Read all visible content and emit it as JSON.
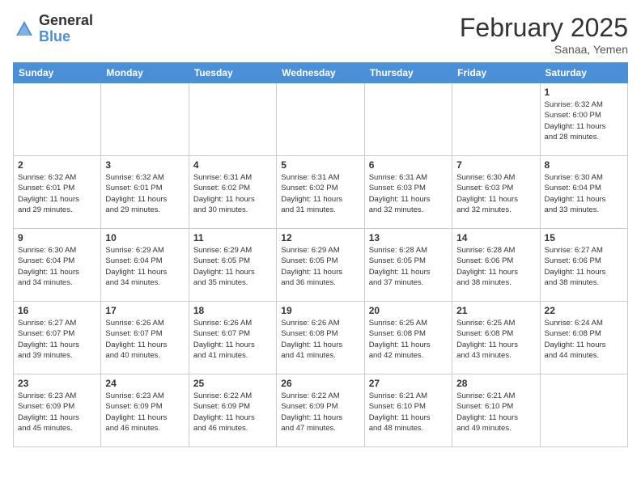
{
  "logo": {
    "general": "General",
    "blue": "Blue"
  },
  "title": "February 2025",
  "location": "Sanaa, Yemen",
  "days_of_week": [
    "Sunday",
    "Monday",
    "Tuesday",
    "Wednesday",
    "Thursday",
    "Friday",
    "Saturday"
  ],
  "weeks": [
    [
      {
        "day": "",
        "info": ""
      },
      {
        "day": "",
        "info": ""
      },
      {
        "day": "",
        "info": ""
      },
      {
        "day": "",
        "info": ""
      },
      {
        "day": "",
        "info": ""
      },
      {
        "day": "",
        "info": ""
      },
      {
        "day": "1",
        "info": "Sunrise: 6:32 AM\nSunset: 6:00 PM\nDaylight: 11 hours\nand 28 minutes."
      }
    ],
    [
      {
        "day": "2",
        "info": "Sunrise: 6:32 AM\nSunset: 6:01 PM\nDaylight: 11 hours\nand 29 minutes."
      },
      {
        "day": "3",
        "info": "Sunrise: 6:32 AM\nSunset: 6:01 PM\nDaylight: 11 hours\nand 29 minutes."
      },
      {
        "day": "4",
        "info": "Sunrise: 6:31 AM\nSunset: 6:02 PM\nDaylight: 11 hours\nand 30 minutes."
      },
      {
        "day": "5",
        "info": "Sunrise: 6:31 AM\nSunset: 6:02 PM\nDaylight: 11 hours\nand 31 minutes."
      },
      {
        "day": "6",
        "info": "Sunrise: 6:31 AM\nSunset: 6:03 PM\nDaylight: 11 hours\nand 32 minutes."
      },
      {
        "day": "7",
        "info": "Sunrise: 6:30 AM\nSunset: 6:03 PM\nDaylight: 11 hours\nand 32 minutes."
      },
      {
        "day": "8",
        "info": "Sunrise: 6:30 AM\nSunset: 6:04 PM\nDaylight: 11 hours\nand 33 minutes."
      }
    ],
    [
      {
        "day": "9",
        "info": "Sunrise: 6:30 AM\nSunset: 6:04 PM\nDaylight: 11 hours\nand 34 minutes."
      },
      {
        "day": "10",
        "info": "Sunrise: 6:29 AM\nSunset: 6:04 PM\nDaylight: 11 hours\nand 34 minutes."
      },
      {
        "day": "11",
        "info": "Sunrise: 6:29 AM\nSunset: 6:05 PM\nDaylight: 11 hours\nand 35 minutes."
      },
      {
        "day": "12",
        "info": "Sunrise: 6:29 AM\nSunset: 6:05 PM\nDaylight: 11 hours\nand 36 minutes."
      },
      {
        "day": "13",
        "info": "Sunrise: 6:28 AM\nSunset: 6:05 PM\nDaylight: 11 hours\nand 37 minutes."
      },
      {
        "day": "14",
        "info": "Sunrise: 6:28 AM\nSunset: 6:06 PM\nDaylight: 11 hours\nand 38 minutes."
      },
      {
        "day": "15",
        "info": "Sunrise: 6:27 AM\nSunset: 6:06 PM\nDaylight: 11 hours\nand 38 minutes."
      }
    ],
    [
      {
        "day": "16",
        "info": "Sunrise: 6:27 AM\nSunset: 6:07 PM\nDaylight: 11 hours\nand 39 minutes."
      },
      {
        "day": "17",
        "info": "Sunrise: 6:26 AM\nSunset: 6:07 PM\nDaylight: 11 hours\nand 40 minutes."
      },
      {
        "day": "18",
        "info": "Sunrise: 6:26 AM\nSunset: 6:07 PM\nDaylight: 11 hours\nand 41 minutes."
      },
      {
        "day": "19",
        "info": "Sunrise: 6:26 AM\nSunset: 6:08 PM\nDaylight: 11 hours\nand 41 minutes."
      },
      {
        "day": "20",
        "info": "Sunrise: 6:25 AM\nSunset: 6:08 PM\nDaylight: 11 hours\nand 42 minutes."
      },
      {
        "day": "21",
        "info": "Sunrise: 6:25 AM\nSunset: 6:08 PM\nDaylight: 11 hours\nand 43 minutes."
      },
      {
        "day": "22",
        "info": "Sunrise: 6:24 AM\nSunset: 6:08 PM\nDaylight: 11 hours\nand 44 minutes."
      }
    ],
    [
      {
        "day": "23",
        "info": "Sunrise: 6:23 AM\nSunset: 6:09 PM\nDaylight: 11 hours\nand 45 minutes."
      },
      {
        "day": "24",
        "info": "Sunrise: 6:23 AM\nSunset: 6:09 PM\nDaylight: 11 hours\nand 46 minutes."
      },
      {
        "day": "25",
        "info": "Sunrise: 6:22 AM\nSunset: 6:09 PM\nDaylight: 11 hours\nand 46 minutes."
      },
      {
        "day": "26",
        "info": "Sunrise: 6:22 AM\nSunset: 6:09 PM\nDaylight: 11 hours\nand 47 minutes."
      },
      {
        "day": "27",
        "info": "Sunrise: 6:21 AM\nSunset: 6:10 PM\nDaylight: 11 hours\nand 48 minutes."
      },
      {
        "day": "28",
        "info": "Sunrise: 6:21 AM\nSunset: 6:10 PM\nDaylight: 11 hours\nand 49 minutes."
      },
      {
        "day": "",
        "info": ""
      }
    ]
  ]
}
